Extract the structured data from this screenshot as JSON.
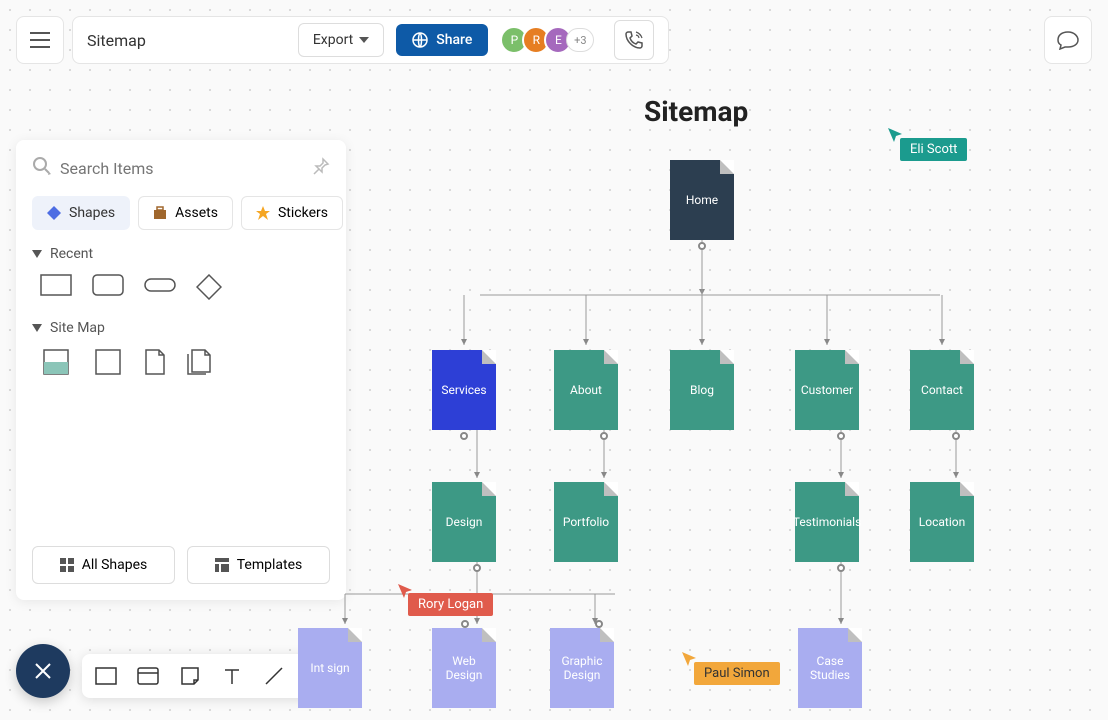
{
  "header": {
    "title": "Sitemap",
    "export_label": "Export",
    "share_label": "Share",
    "avatars": [
      "P",
      "R",
      "E"
    ],
    "avatar_more": "+3"
  },
  "panel": {
    "search_placeholder": "Search Items",
    "tabs": {
      "shapes": "Shapes",
      "assets": "Assets",
      "stickers": "Stickers"
    },
    "sections": {
      "recent": "Recent",
      "sitemap": "Site Map"
    },
    "footer": {
      "all_shapes": "All Shapes",
      "templates": "Templates"
    }
  },
  "canvas": {
    "title": "Sitemap",
    "nodes": {
      "home": "Home",
      "services": "Services",
      "about": "About",
      "blog": "Blog",
      "customer": "Customer",
      "contact": "Contact",
      "design": "Design",
      "portfolio": "Portfolio",
      "testimonials": "Testimonials",
      "location": "Location",
      "int_design": "Int\nsign",
      "web_design": "Web Design",
      "graphic_design": "Graphic Design",
      "case_studies": "Case Studies"
    },
    "cursors": {
      "eli": "Eli Scott",
      "rory": "Rory Logan",
      "paul": "Paul Simon"
    }
  }
}
